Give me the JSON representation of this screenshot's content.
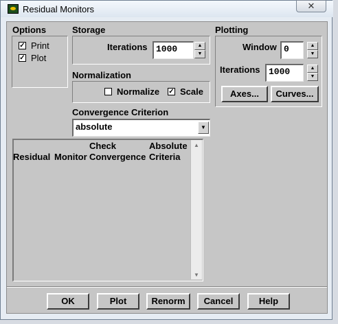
{
  "window": {
    "title": "Residual Monitors",
    "close_glyph": "✕"
  },
  "options": {
    "title": "Options",
    "print": {
      "label": "Print",
      "checked": true
    },
    "plot": {
      "label": "Plot",
      "checked": true
    }
  },
  "storage": {
    "title": "Storage",
    "iterations_label": "Iterations",
    "iterations_value": "1000"
  },
  "normalization": {
    "title": "Normalization",
    "normalize": {
      "label": "Normalize",
      "checked": false
    },
    "scale": {
      "label": "Scale",
      "checked": true
    }
  },
  "convergence": {
    "title": "Convergence Criterion",
    "selected": "absolute"
  },
  "plotting": {
    "title": "Plotting",
    "window_label": "Window",
    "window_value": "0",
    "iterations_label": "Iterations",
    "iterations_value": "1000",
    "axes_label": "Axes...",
    "curves_label": "Curves..."
  },
  "table": {
    "col1": "Residual",
    "col2": "Monitor",
    "col3_line1": "Check",
    "col3_line2": "Convergence",
    "col4_line1": "Absolute",
    "col4_line2": "Criteria"
  },
  "buttons": {
    "ok": "OK",
    "plot": "Plot",
    "renorm": "Renorm",
    "cancel": "Cancel",
    "help": "Help"
  },
  "glyphs": {
    "check": "✓",
    "up": "▲",
    "down": "▼",
    "dropdown": "▼"
  }
}
